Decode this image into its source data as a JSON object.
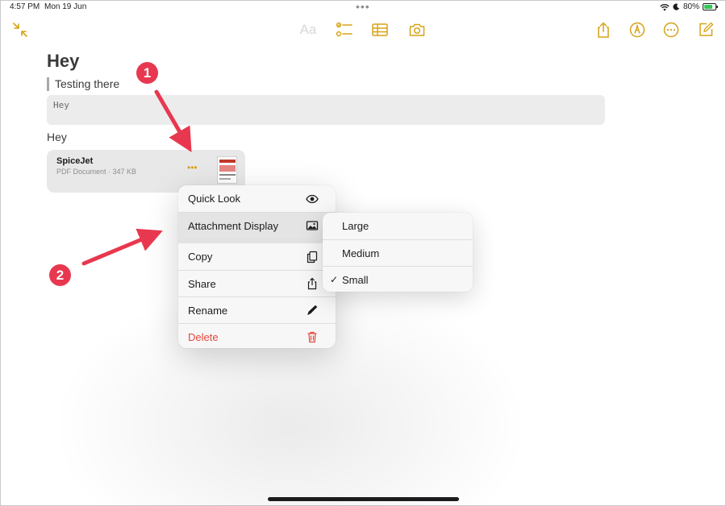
{
  "status_bar": {
    "time": "4:57 PM",
    "date": "Mon 19 Jun",
    "multitask_dots": "•••",
    "battery_percent": "80%",
    "battery_level": 0.8
  },
  "toolbar": {
    "text_format_label": "Aa",
    "accent_color": "#d6a216",
    "icons": [
      "collapse-icon",
      "checklist-icon",
      "table-icon",
      "camera-icon",
      "share-icon",
      "markup-icon",
      "more-icon",
      "compose-icon"
    ]
  },
  "note": {
    "title": "Hey",
    "quote": "Testing there",
    "code": "Hey",
    "body": "Hey"
  },
  "attachment": {
    "name": "SpiceJet",
    "meta": "PDF Document · 347 KB",
    "more": "•••"
  },
  "context_menu": {
    "items": [
      {
        "label": "Quick Look",
        "icon": "eye-icon"
      },
      {
        "label": "Attachment Display",
        "icon": "image-icon"
      },
      {
        "label": "Copy",
        "icon": "copy-icon"
      },
      {
        "label": "Share",
        "icon": "share-icon"
      },
      {
        "label": "Rename",
        "icon": "pencil-icon"
      },
      {
        "label": "Delete",
        "icon": "trash-icon",
        "color": "#e5483d"
      }
    ]
  },
  "display_submenu": {
    "items": [
      "Large",
      "Medium",
      "Small"
    ],
    "selected": "Small",
    "check": "✓"
  },
  "annotations": {
    "badge_1": "1",
    "badge_2": "2",
    "color": "#e8384f"
  }
}
